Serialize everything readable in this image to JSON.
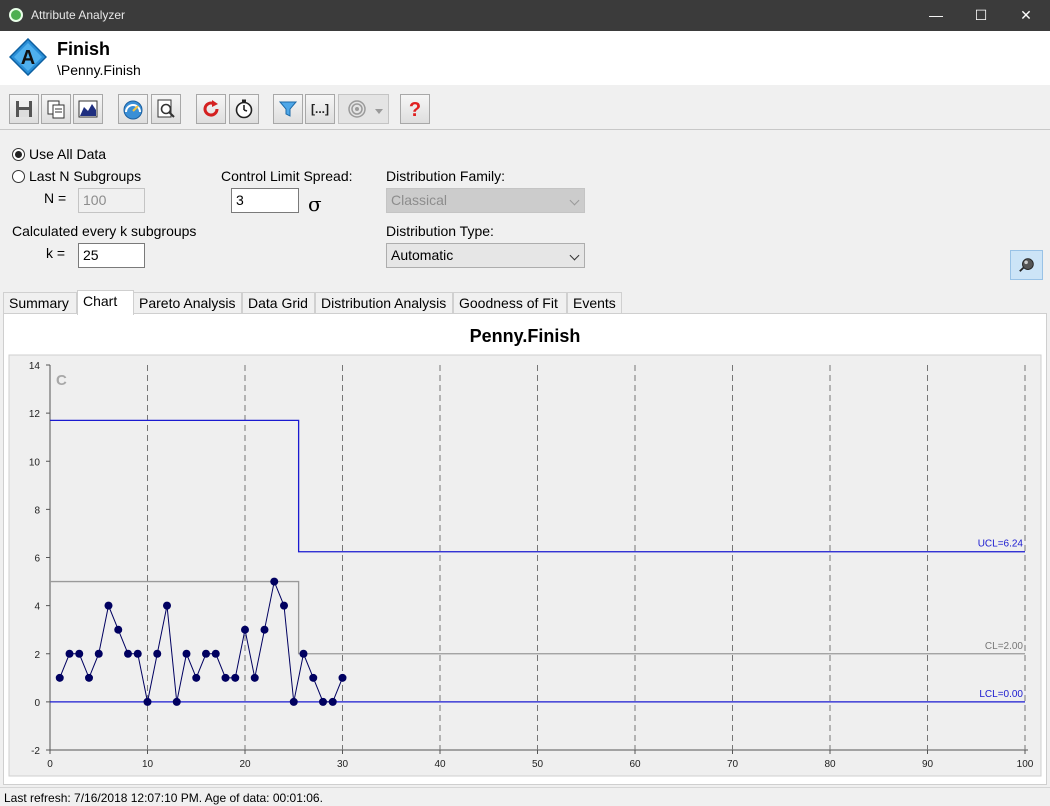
{
  "window": {
    "title": "Attribute Analyzer",
    "minimize": "—",
    "maximize": "☐",
    "close": "✕"
  },
  "header": {
    "name": "Finish",
    "path": "\\Penny.Finish",
    "logo_letter": "A"
  },
  "toolbar": {
    "buttons": [
      {
        "icon": "save-icon"
      },
      {
        "icon": "copy-icon"
      },
      {
        "icon": "chart-image-icon"
      },
      {
        "icon": "gauge-icon"
      },
      {
        "icon": "search-icon"
      },
      {
        "icon": "refresh-icon"
      },
      {
        "icon": "timer-icon"
      },
      {
        "icon": "filter-icon"
      },
      {
        "icon": "bracket-icon"
      },
      {
        "icon": "target-icon"
      },
      {
        "icon": "help-icon"
      }
    ]
  },
  "settings": {
    "use_all_data": "Use All Data",
    "last_n": "Last N Subgroups",
    "n_label": "N =",
    "n_value": "100",
    "calc_label": "Calculated every k subgroups",
    "k_label": "k =",
    "k_value": "25",
    "spread_label": "Control Limit Spread:",
    "spread_value": "3",
    "sigma": "σ",
    "family_label": "Distribution Family:",
    "family_value": "Classical",
    "type_label": "Distribution Type:",
    "type_value": "Automatic"
  },
  "tabs": [
    "Summary",
    "Chart",
    "Pareto Analysis",
    "Data Grid",
    "Distribution Analysis",
    "Goodness of Fit",
    "Events"
  ],
  "status": "Last refresh: 7/16/2018 12:07:10 PM.  Age of data: 00:01:06.",
  "colors": {
    "ucl": "#1a1ad0",
    "cl": "#9a9a9a",
    "lcl": "#1a1ad0",
    "points": "#000060"
  },
  "chart_data": {
    "type": "line",
    "title": "Penny.Finish",
    "chart_letter": "C",
    "xlim": [
      0,
      100
    ],
    "ylim": [
      -2,
      14
    ],
    "xticks": [
      0,
      10,
      20,
      30,
      40,
      50,
      60,
      70,
      80,
      90,
      100
    ],
    "yticks": [
      -2,
      0,
      2,
      4,
      6,
      8,
      10,
      12,
      14
    ],
    "grid": true,
    "series": [
      {
        "x": [
          1,
          2,
          3,
          4,
          5,
          6,
          7,
          8,
          9,
          10,
          11,
          12,
          13,
          14,
          15,
          16,
          17,
          18,
          19,
          20,
          21,
          22,
          23,
          24,
          25,
          26,
          27,
          28,
          29,
          30
        ],
        "values": [
          1,
          2,
          2,
          1,
          2,
          4,
          3,
          2,
          2,
          0,
          2,
          4,
          0,
          2,
          1,
          2,
          2,
          1,
          1,
          3,
          1,
          3,
          5,
          4,
          0,
          2,
          1,
          0,
          0,
          1
        ]
      }
    ],
    "limits": {
      "ucl": {
        "segments": [
          [
            0,
            25.5,
            11.7
          ],
          [
            25.5,
            100,
            6.24
          ]
        ],
        "label": "UCL=6.24"
      },
      "cl": {
        "segments": [
          [
            0,
            25.5,
            5.0
          ],
          [
            25.5,
            100,
            2.0
          ]
        ],
        "label": "CL=2.00"
      },
      "lcl": {
        "segments": [
          [
            0,
            100,
            0
          ]
        ],
        "label": "LCL=0.00"
      }
    }
  }
}
